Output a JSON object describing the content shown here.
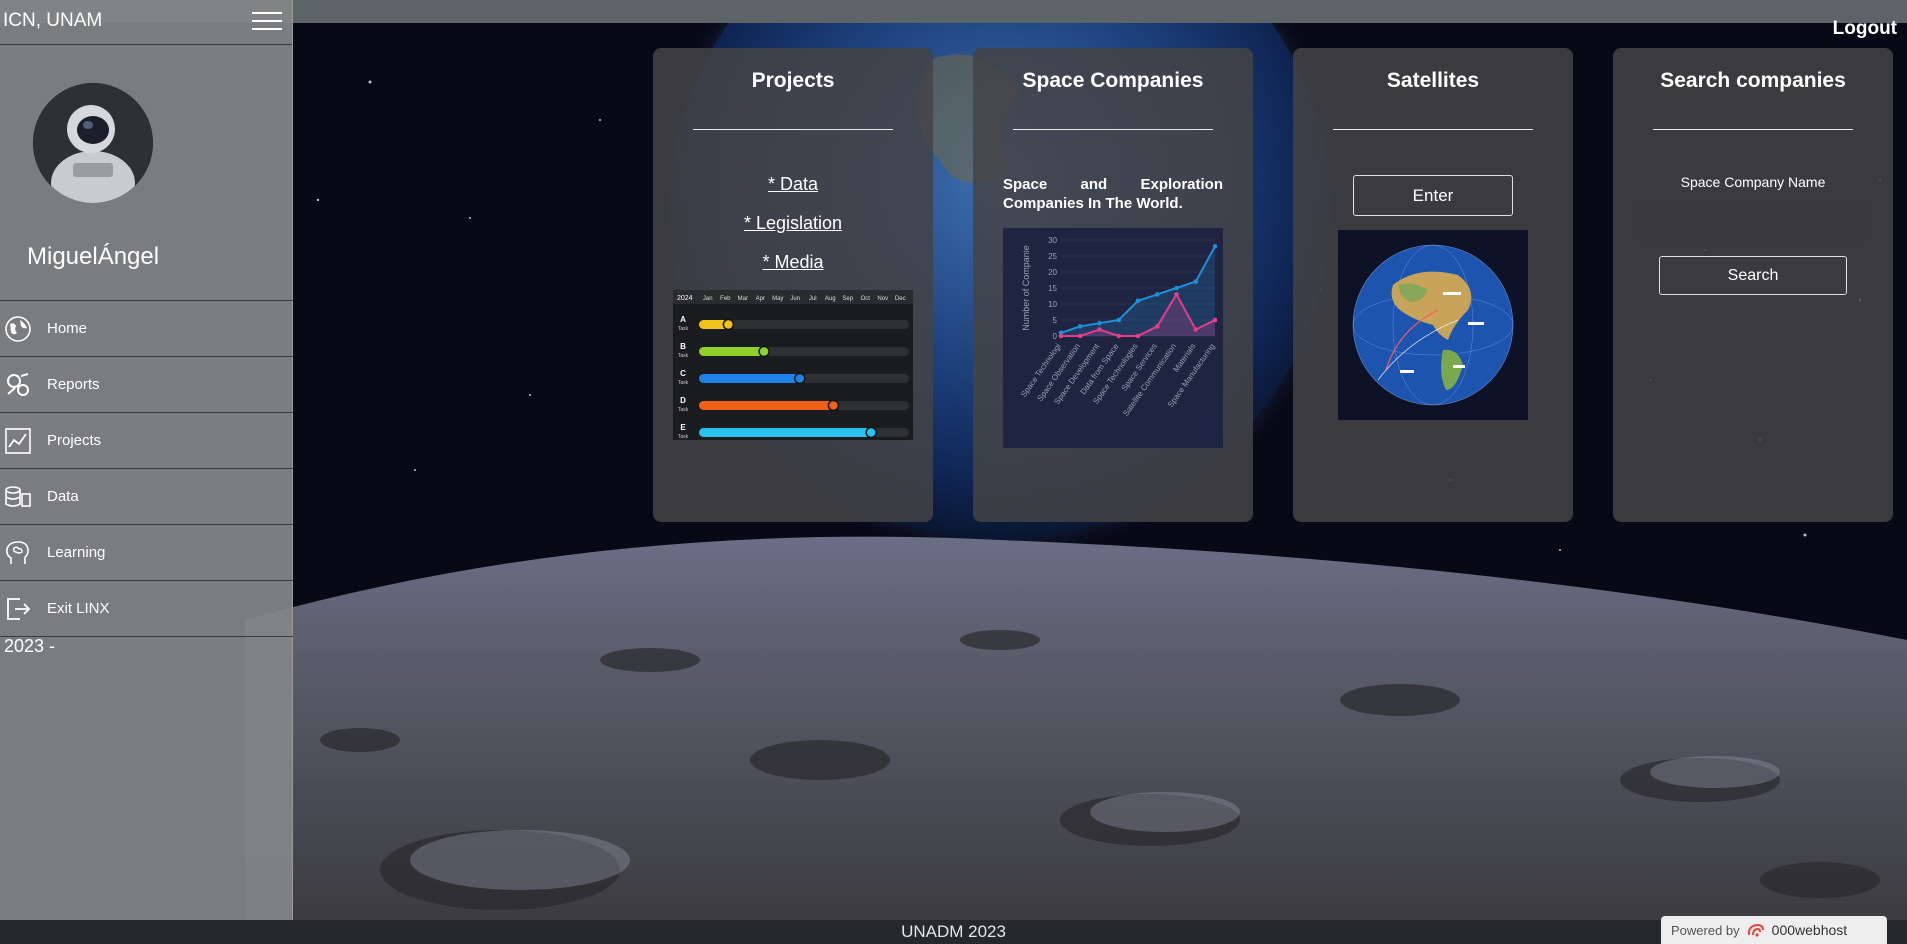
{
  "sidebar": {
    "title": "ICN, UNAM",
    "username": "MiguelÁngel",
    "items": [
      {
        "label": "Home",
        "icon": "globe-icon"
      },
      {
        "label": "Reports",
        "icon": "reports-icon"
      },
      {
        "label": "Projects",
        "icon": "chart-icon"
      },
      {
        "label": "Data",
        "icon": "data-icon"
      },
      {
        "label": "Learning",
        "icon": "brain-icon"
      },
      {
        "label": "Exit LINX",
        "icon": "exit-icon"
      }
    ],
    "year": "2023 -"
  },
  "header": {
    "logout": "Logout"
  },
  "cards": {
    "projects": {
      "title": "Projects",
      "links": [
        "* Data",
        "* Legislation",
        "* Media"
      ]
    },
    "companies": {
      "title": "Space Companies",
      "description": "Space and Exploration Companies In The World."
    },
    "satellites": {
      "title": "Satellites",
      "button": "Enter"
    },
    "search": {
      "title": "Search companies",
      "label": "Space Company Name",
      "input_value": "",
      "button": "Search"
    }
  },
  "gantt": {
    "year_label": "2024",
    "months": [
      "Jan",
      "Feb",
      "Mar",
      "Apr",
      "May",
      "Jun",
      "Jul",
      "Aug",
      "Sep",
      "Oct",
      "Nov",
      "Dec"
    ],
    "tasks": [
      {
        "letter": "A",
        "sub": "Task",
        "progress": 0.14,
        "color": "#f2c318"
      },
      {
        "letter": "B",
        "sub": "Task",
        "progress": 0.31,
        "color": "#8fd12a"
      },
      {
        "letter": "C",
        "sub": "Task",
        "progress": 0.48,
        "color": "#1f82e8"
      },
      {
        "letter": "D",
        "sub": "Task",
        "progress": 0.64,
        "color": "#f0621a"
      },
      {
        "letter": "E",
        "sub": "Task",
        "progress": 0.82,
        "color": "#27c2ee"
      }
    ]
  },
  "chart_data": {
    "type": "line",
    "title": "",
    "xlabel": "",
    "ylabel": "Number of Companie",
    "ylim": [
      0,
      30
    ],
    "yticks": [
      0,
      5,
      10,
      15,
      20,
      25,
      30
    ],
    "categories": [
      "Space Technologi",
      "Space Observation",
      "Space Development",
      "Data from Space",
      "Space Technologies",
      "Space Services",
      "Satellite Communication",
      "Materials",
      "Space Manufacturing"
    ],
    "series": [
      {
        "values": [
          1,
          3,
          4,
          5,
          11,
          13,
          15,
          17,
          28
        ],
        "color": "#1e8fd8"
      },
      {
        "values": [
          0,
          0,
          2,
          0,
          0,
          3,
          13,
          2,
          5
        ],
        "color": "#e63c8c"
      }
    ],
    "grid": true
  },
  "footer": {
    "text": "UNADM 2023",
    "powered_by": "Powered by",
    "host": "000webhost"
  }
}
